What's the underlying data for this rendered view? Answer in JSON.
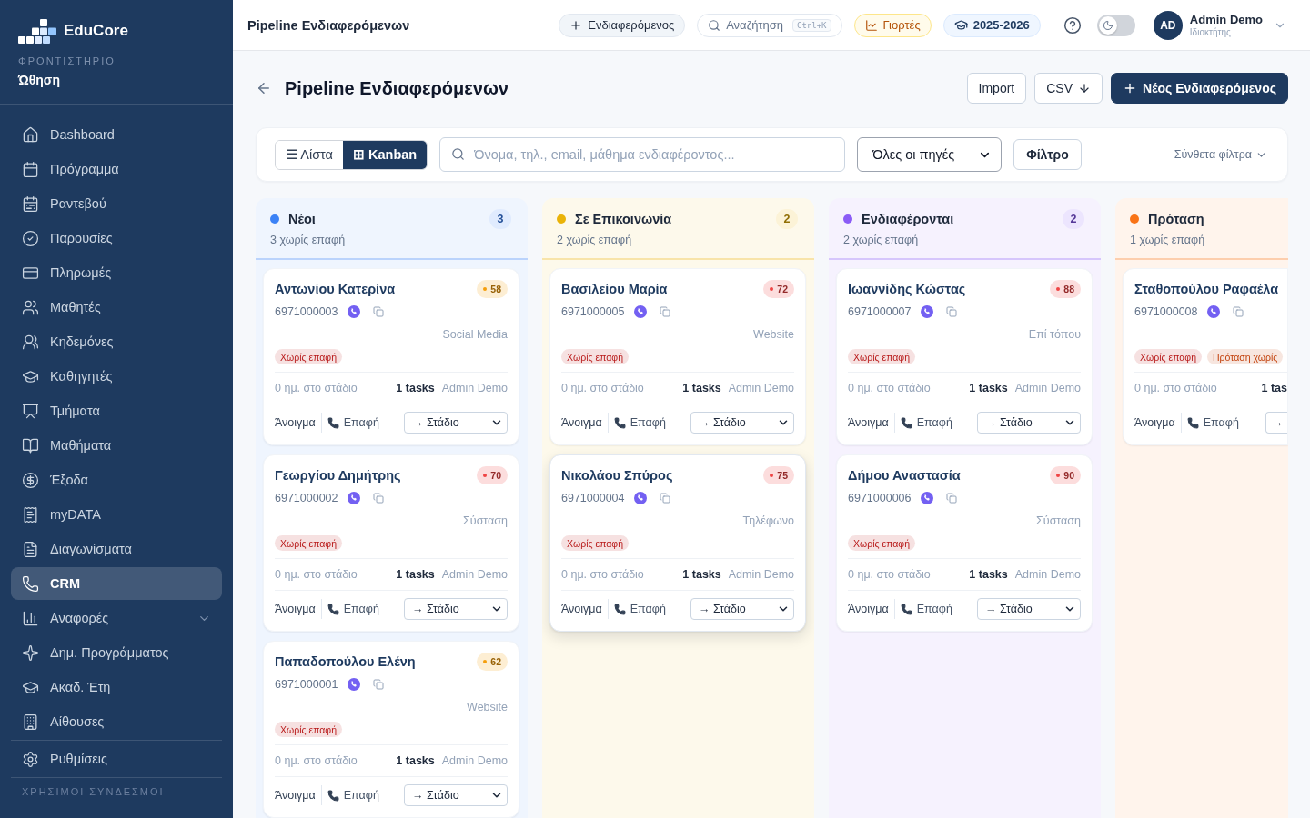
{
  "sidebar": {
    "brand": "EduCore",
    "org_label": "ΦΡΟΝΤΙΣΤΗΡΙΟ",
    "org_name": "Ώθηση",
    "items": [
      {
        "label": "Dashboard",
        "kind": "link",
        "selected": false
      },
      {
        "label": "Πρόγραμμα",
        "kind": "link",
        "selected": false
      },
      {
        "label": "Ραντεβού",
        "kind": "link",
        "selected": false
      },
      {
        "label": "Παρουσίες",
        "kind": "link",
        "selected": false
      },
      {
        "label": "Πληρωμές",
        "kind": "link",
        "selected": false
      },
      {
        "label": "Μαθητές",
        "kind": "link",
        "selected": false
      },
      {
        "label": "Κηδεμόνες",
        "kind": "link",
        "selected": false
      },
      {
        "label": "Καθηγητές",
        "kind": "link",
        "selected": false
      },
      {
        "label": "Τμήματα",
        "kind": "link",
        "selected": false
      },
      {
        "label": "Μαθήματα",
        "kind": "link",
        "selected": false
      },
      {
        "label": "Έξοδα",
        "kind": "link",
        "selected": false
      },
      {
        "label": "myDATA",
        "kind": "link",
        "selected": false
      },
      {
        "label": "Διαγωνίσματα",
        "kind": "link",
        "selected": false
      },
      {
        "label": "CRM",
        "kind": "link",
        "selected": true
      },
      {
        "label": "Αναφορές",
        "kind": "group",
        "selected": false,
        "expanded": false
      },
      {
        "label": "Δημ. Προγράμματος",
        "kind": "link",
        "selected": false
      },
      {
        "label": "Ακαδ. Έτη",
        "kind": "link",
        "selected": false
      },
      {
        "label": "Αίθουσες",
        "kind": "link",
        "selected": false
      }
    ],
    "bottom_items": [
      {
        "label": "Ρυθμίσεις",
        "selected": false
      }
    ],
    "section_label": "ΧΡΗΣΙΜΟΙ ΣΥΝΔΕΣΜΟΙ"
  },
  "topbar": {
    "title": "Pipeline Ενδιαφερόμενων",
    "add_label": "Ενδιαφερόμενος",
    "search_label": "Αναζήτηση",
    "search_shortcut": "Ctrl+K",
    "holidays_label": "Γιορτές",
    "year_label": "2025-2026",
    "dark_mode": false,
    "user": {
      "initials": "AD",
      "name": "Admin Demo",
      "role": "Ιδιοκτήτης"
    }
  },
  "header": {
    "title": "Pipeline Ενδιαφερόμενων",
    "actions": [
      {
        "label": "Import",
        "kind": "plain"
      },
      {
        "label": "CSV",
        "kind": "download"
      },
      {
        "label": "Νέος Ενδιαφερόμενος",
        "kind": "primary"
      }
    ]
  },
  "filters": {
    "views": [
      {
        "label": "☰ Λίστα",
        "selected": false
      },
      {
        "label": "⊞ Kanban",
        "selected": true
      }
    ],
    "search": {
      "placeholder": "Όνομα, τηλ., email, μάθημα ενδιαφέροντος..."
    },
    "source_select": "Όλες οι πηγές",
    "filter_button": "Φίλτρο",
    "advanced_label": "Σύνθετα φίλτρα"
  },
  "columns": [
    {
      "title": "Νέοι",
      "color": "#3b82f6",
      "count": "3",
      "subtitle": "3 χωρίς επαφή",
      "cards": [
        {
          "name": "Αντωνίου Κατερίνα",
          "score": {
            "value": "58",
            "color": "#f59e0b"
          },
          "phone": "6971000003",
          "source": "Social Media",
          "tags": [
            {
              "label": "Χωρίς επαφή",
              "color": "#b91c1c"
            }
          ],
          "days_in_stage": "0 ημ. στο στάδιο",
          "tasks": "1 tasks",
          "assignee": "Admin Demo",
          "open_label": "Άνοιγμα",
          "contact_label": "Επαφή",
          "stage_select": "→ Στάδιο",
          "highlighted": false
        },
        {
          "name": "Γεωργίου Δημήτρης",
          "score": {
            "value": "70",
            "color": "#ef4444"
          },
          "phone": "6971000002",
          "source": "Σύσταση",
          "tags": [
            {
              "label": "Χωρίς επαφή",
              "color": "#b91c1c"
            }
          ],
          "days_in_stage": "0 ημ. στο στάδιο",
          "tasks": "1 tasks",
          "assignee": "Admin Demo",
          "open_label": "Άνοιγμα",
          "contact_label": "Επαφή",
          "stage_select": "→ Στάδιο",
          "highlighted": false
        },
        {
          "name": "Παπαδοπούλου Ελένη",
          "score": {
            "value": "62",
            "color": "#f59e0b"
          },
          "phone": "6971000001",
          "source": "Website",
          "tags": [
            {
              "label": "Χωρίς επαφή",
              "color": "#b91c1c"
            }
          ],
          "days_in_stage": "0 ημ. στο στάδιο",
          "tasks": "1 tasks",
          "assignee": "Admin Demo",
          "open_label": "Άνοιγμα",
          "contact_label": "Επαφή",
          "stage_select": "→ Στάδιο",
          "highlighted": false
        }
      ]
    },
    {
      "title": "Σε Επικοινωνία",
      "color": "#eab308",
      "count": "2",
      "subtitle": "2 χωρίς επαφή",
      "cards": [
        {
          "name": "Βασιλείου Μαρία",
          "score": {
            "value": "72",
            "color": "#ef4444"
          },
          "phone": "6971000005",
          "source": "Website",
          "tags": [
            {
              "label": "Χωρίς επαφή",
              "color": "#b91c1c"
            }
          ],
          "days_in_stage": "0 ημ. στο στάδιο",
          "tasks": "1 tasks",
          "assignee": "Admin Demo",
          "open_label": "Άνοιγμα",
          "contact_label": "Επαφή",
          "stage_select": "→ Στάδιο",
          "highlighted": false
        },
        {
          "name": "Νικολάου Σπύρος",
          "score": {
            "value": "75",
            "color": "#ef4444"
          },
          "phone": "6971000004",
          "source": "Τηλέφωνο",
          "tags": [
            {
              "label": "Χωρίς επαφή",
              "color": "#b91c1c"
            }
          ],
          "days_in_stage": "0 ημ. στο στάδιο",
          "tasks": "1 tasks",
          "assignee": "Admin Demo",
          "open_label": "Άνοιγμα",
          "contact_label": "Επαφή",
          "stage_select": "→ Στάδιο",
          "highlighted": true
        }
      ]
    },
    {
      "title": "Ενδιαφέρονται",
      "color": "#8b5cf6",
      "count": "2",
      "subtitle": "2 χωρίς επαφή",
      "cards": [
        {
          "name": "Ιωαννίδης Κώστας",
          "score": {
            "value": "88",
            "color": "#ef4444"
          },
          "phone": "6971000007",
          "source": "Επί τόπου",
          "tags": [
            {
              "label": "Χωρίς επαφή",
              "color": "#b91c1c"
            }
          ],
          "days_in_stage": "0 ημ. στο στάδιο",
          "tasks": "1 tasks",
          "assignee": "Admin Demo",
          "open_label": "Άνοιγμα",
          "contact_label": "Επαφή",
          "stage_select": "→ Στάδιο",
          "highlighted": false
        },
        {
          "name": "Δήμου Αναστασία",
          "score": {
            "value": "90",
            "color": "#ef4444"
          },
          "phone": "6971000006",
          "source": "Σύσταση",
          "tags": [
            {
              "label": "Χωρίς επαφή",
              "color": "#b91c1c"
            }
          ],
          "days_in_stage": "0 ημ. στο στάδιο",
          "tasks": "1 tasks",
          "assignee": "Admin Demo",
          "open_label": "Άνοιγμα",
          "contact_label": "Επαφή",
          "stage_select": "→ Στάδιο",
          "highlighted": false
        }
      ]
    },
    {
      "title": "Πρόταση",
      "color": "#f97316",
      "subtitle": "1 χωρίς επαφή",
      "cards": [
        {
          "name": "Σταθοπούλου Ραφαέλα",
          "phone": "6971000008",
          "tags": [
            {
              "label": "Χωρίς επαφή",
              "color": "#b91c1c"
            },
            {
              "label": "Πρόταση χωρίς",
              "color": "#c2410c"
            }
          ],
          "days_in_stage": "0 ημ. στο στάδιο",
          "tasks": "1 tas",
          "open_label": "Άνοιγμα",
          "contact_label": "Επαφή",
          "stage_select": "→",
          "highlighted": false
        }
      ]
    }
  ]
}
